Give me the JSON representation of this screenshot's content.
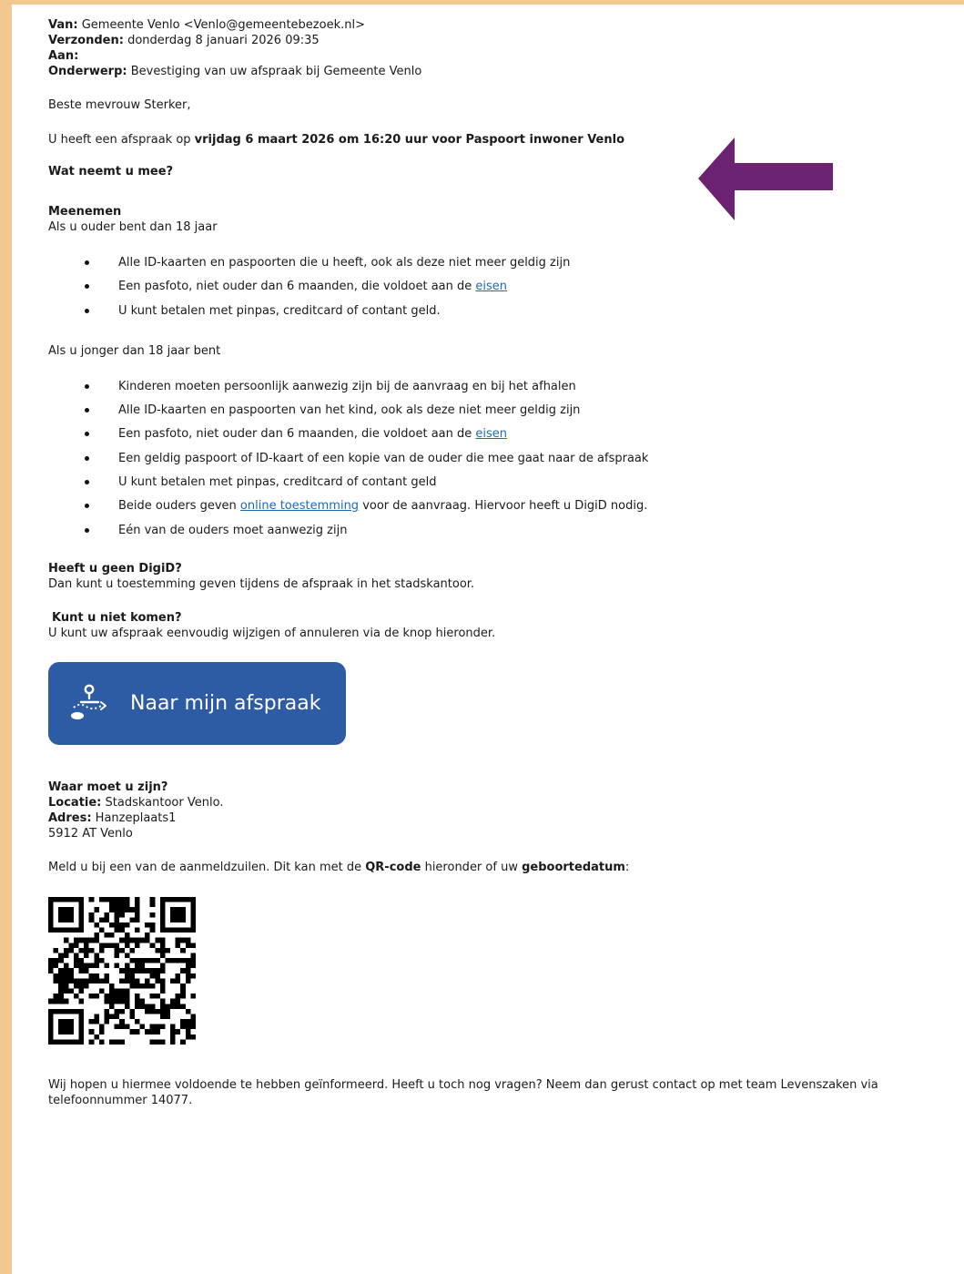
{
  "header": {
    "from_label": "Van:",
    "from_value": "Gemeente Venlo <Venlo@gemeentebezoek.nl>",
    "sent_label": "Verzonden:",
    "sent_value": "donderdag 8 januari 2026 09:35",
    "to_label": "Aan:",
    "subject_label": "Onderwerp:",
    "subject_value": "Bevestiging van uw afspraak bij Gemeente Venlo"
  },
  "greeting": "Beste mevrouw Sterker,",
  "appointment": {
    "prefix": "U heeft een afspraak op ",
    "details": "vrijdag 6 maart 2026 om 16:20 uur voor Paspoort inwoner Venlo"
  },
  "what_to_bring_heading": "Wat neemt u mee?",
  "meenemen": {
    "heading": "Meenemen",
    "adult_intro": "Als u ouder bent dan 18 jaar",
    "adult_items": [
      "Alle ID-kaarten en paspoorten die u heeft, ook als deze niet meer geldig zijn",
      "Een pasfoto, niet ouder dan 6 maanden, die voldoet aan de ",
      "U kunt betalen met pinpas, creditcard of contant geld."
    ],
    "eisen_link": "eisen",
    "minor_intro": "Als u jonger dan 18 jaar bent",
    "minor_items": [
      "Kinderen moeten persoonlijk aanwezig zijn bij de aanvraag en bij het afhalen",
      "Alle ID-kaarten en paspoorten van het kind, ook als deze niet meer geldig zijn",
      "Een pasfoto, niet ouder dan 6 maanden, die voldoet aan de ",
      "Een geldig paspoort of ID-kaart of een kopie van de ouder die mee gaat naar de afspraak",
      "U kunt betalen met pinpas, creditcard of contant geld",
      "Beide ouders geven ",
      "Eén van de ouders moet aanwezig zijn"
    ],
    "consent_link": "online toestemming",
    "consent_suffix": " voor de aanvraag. Hiervoor heeft u DigiD nodig."
  },
  "no_digid": {
    "heading": "Heeft u geen DigiD?",
    "text": "Dan kunt u toestemming geven tijdens de afspraak in het stadskantoor."
  },
  "cannot_come": {
    "heading": "Kunt u niet komen?",
    "text": "U kunt uw afspraak eenvoudig wijzigen of annuleren via de knop hieronder."
  },
  "appointment_button": {
    "label": "Naar mijn afspraak",
    "icon": "location-route-icon",
    "color": "#2d5ba4"
  },
  "location": {
    "heading": "Waar moet u zijn?",
    "location_label": "Locatie:",
    "location_value": "Stadskantoor Venlo.",
    "address_label": "Adres:",
    "address_value": "Hanzeplaats1",
    "postal": "5912 AT Venlo"
  },
  "checkin": {
    "prefix": "Meld u bij een van de aanmeldzuilen. Dit kan met de ",
    "qr_bold": "QR-code",
    "middle": " hieronder of uw ",
    "dob_bold": "geboortedatum",
    "suffix": ":"
  },
  "footer": {
    "line1": "Wij hopen u hiermee voldoende te hebben geïnformeerd. Heeft u toch nog vragen? Neem dan gerust contact op met team Levenszaken via",
    "line2": "telefoonnummer 14077."
  },
  "colors": {
    "frame": "#f3c88f",
    "link": "#1f6ab5",
    "arrow": "#6b2270"
  }
}
